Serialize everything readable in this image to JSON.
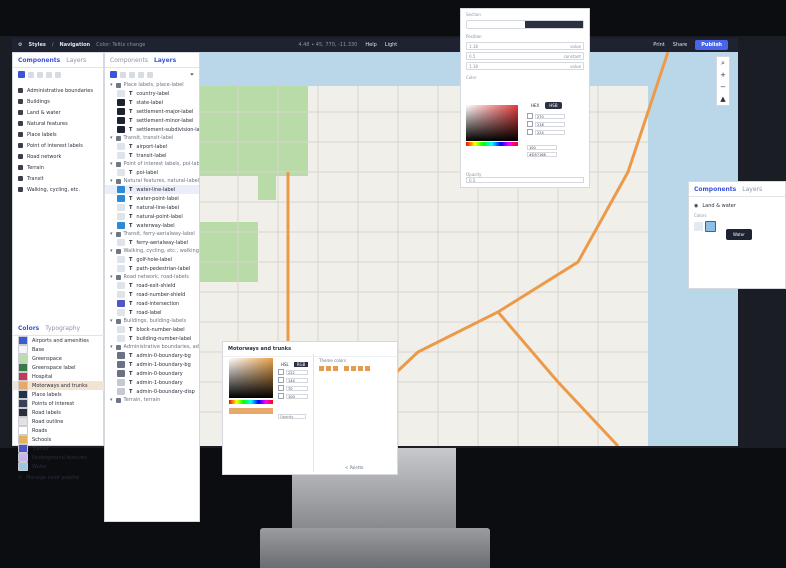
{
  "topbar": {
    "app": "Styles",
    "section": "Navigation",
    "subtitle": "Color: Teltix change",
    "coords": "4.48 ∙ 45, 770, -11.330",
    "help": "Help",
    "light": "Light",
    "print": "Print",
    "share": "Share",
    "publish": "Publish"
  },
  "components": {
    "tab_components": "Components",
    "tab_layers": "Layers",
    "items": [
      "Administrative boundaries",
      "Buildings",
      "Land & water",
      "Natural features",
      "Place labels",
      "Point of interest labels",
      "Road network",
      "Terrain",
      "Transit",
      "Walking, cycling, etc."
    ]
  },
  "colors": {
    "tab_colors": "Colors",
    "tab_typography": "Typography",
    "items": [
      {
        "label": "Airports and amenities",
        "color": "#3b5bd0"
      },
      {
        "label": "Base",
        "color": "#f4f4f4"
      },
      {
        "label": "Greenspace",
        "color": "#b8e0a8"
      },
      {
        "label": "Greenspace label",
        "color": "#3c7a45"
      },
      {
        "label": "Hospital",
        "color": "#c13a5a"
      },
      {
        "label": "Motorways and trunks",
        "color": "#e7a86a"
      },
      {
        "label": "Place labels",
        "color": "#24314a"
      },
      {
        "label": "Points of interest",
        "color": "#3a4258"
      },
      {
        "label": "Road labels",
        "color": "#2a2f3b"
      },
      {
        "label": "Road outline",
        "color": "#e2e2e2"
      },
      {
        "label": "Roads",
        "color": "#ffffff"
      },
      {
        "label": "Schools",
        "color": "#e3b25a"
      },
      {
        "label": "Transit",
        "color": "#5055c8"
      },
      {
        "label": "Underground features",
        "color": "#c7b7e8"
      },
      {
        "label": "Water",
        "color": "#9dc6e4"
      }
    ],
    "manage": "Manage color palette"
  },
  "layers": {
    "tab_components": "Components",
    "tab_layers": "Layers",
    "groups": [
      {
        "label": "Place labels, place-label",
        "rows": [
          "country-label",
          "state-label",
          "settlement-major-label",
          "settlement-minor-label",
          "settlement-subdivision-label"
        ]
      },
      {
        "label": "Transit, transit-label",
        "rows": [
          "airport-label",
          "transit-label"
        ]
      },
      {
        "label": "Point of interest labels, poi-lab",
        "rows": [
          "poi-label"
        ]
      },
      {
        "label": "Natural features, natural-labels",
        "rows": [
          "water-line-label",
          "water-point-label",
          "natural-line-label",
          "natural-point-label",
          "waterway-label"
        ]
      },
      {
        "label": "Transit, ferry-aerialway-label",
        "rows": [
          "ferry-aerialway-label"
        ]
      },
      {
        "label": "Walking, cycling, etc., walking",
        "rows": [
          "golf-hole-label",
          "path-pedestrian-label"
        ]
      },
      {
        "label": "Road network, road-labels",
        "rows": [
          "road-exit-shield",
          "road-number-shield",
          "road-intersection",
          "road-label"
        ]
      },
      {
        "label": "Buildings, building-labels",
        "rows": [
          "block-number-label",
          "building-number-label"
        ]
      },
      {
        "label": "Administrative boundaries, ad",
        "rows": [
          "admin-0-boundary-bg",
          "admin-1-boundary-bg",
          "admin-0-boundary",
          "admin-1-boundary",
          "admin-0-boundary-disp"
        ]
      },
      {
        "label": "Terrain, terrain"
      }
    ]
  },
  "picker": {
    "title": "Section",
    "field_label": "Position",
    "inputs": [
      {
        "v": "1.18",
        "u": "value"
      },
      {
        "v": "0.5",
        "u": "constant"
      },
      {
        "v": "1.18",
        "u": "value"
      }
    ],
    "color_label": "Color",
    "mode_hex": "HEX",
    "mode_hsl": "HSB",
    "values": [
      "270",
      "218",
      "224"
    ],
    "extra1": "100",
    "extra2": "#D57168",
    "opacity_label": "Opacity",
    "opacity_value": "0.5"
  },
  "dialog": {
    "title": "Motorways and trunks",
    "mode_a": "HSL",
    "mode_b": "RGB",
    "values": [
      "222",
      "144",
      "70",
      "100"
    ],
    "opacity": "Opacity",
    "preset_label": "Theme colors",
    "footer": "< Palette"
  },
  "layers_card": {
    "tab_components": "Components",
    "tab_layers": "Layers",
    "item": "Land & water",
    "colors_label": "Colors",
    "tooltip": "Water"
  },
  "map_controls": {
    "search": "⌕",
    "zoom_in": "+",
    "zoom_out": "−",
    "compass": "▲"
  }
}
